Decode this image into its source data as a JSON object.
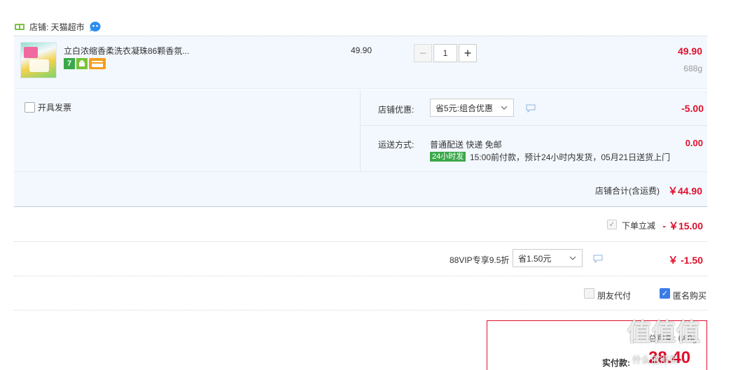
{
  "store": {
    "label": "店铺: 天猫超市",
    "icon": "store-icon",
    "chat_icon": "wangwang-chat-icon"
  },
  "item": {
    "title": "立白浓缩香柔洗衣凝珠86颗香氛...",
    "tags": [
      "7",
      "android",
      "card"
    ],
    "unit_price": "49.90",
    "quantity": "1",
    "minus_label": "−",
    "plus_label": "+",
    "line_total": "49.90",
    "weight": "688g"
  },
  "options": {
    "invoice_label": "开具发票",
    "shop_discount_label": "店铺优惠:",
    "shop_discount_select": "省5元:组合优惠",
    "shop_discount_amount": "-5.00",
    "shipping_label": "运送方式:",
    "shipping_method": "普通配送 快递 免邮",
    "shipping_badge": "24小时发",
    "shipping_detail": "15:00前付款，预计24小时内发货，05月21日送货上门",
    "shipping_amount": "0.00"
  },
  "subtotal": {
    "label": "店铺合计(含运费)",
    "value": "￥44.90"
  },
  "discounts": {
    "order_discount_label": "下单立减",
    "order_discount_amount": "- ￥15.00",
    "vip_label": "88VIP专享9.5折",
    "vip_select": "省1.50元",
    "vip_amount": "￥ -1.50"
  },
  "extras": {
    "friend_pay_label": "朋友代付",
    "anonymous_label": "匿名购买"
  },
  "payment": {
    "weight_text": "总重量: 688g",
    "label": "实付款:",
    "amount": "28.40"
  },
  "watermark": {
    "logo_text": "值值值",
    "url_text": "什么值得买"
  },
  "colors": {
    "price_red": "#e0102c",
    "row_blue": "#f3f8fe",
    "check_blue": "#3b7be8",
    "badge_green": "#3aa84a"
  }
}
